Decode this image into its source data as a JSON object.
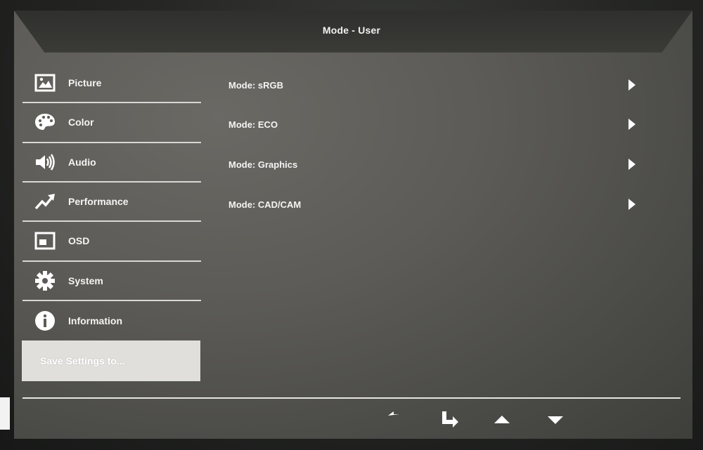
{
  "header": {
    "title": "Mode - User"
  },
  "menu": {
    "items": [
      {
        "id": "picture",
        "label": "Picture",
        "icon": "picture-icon"
      },
      {
        "id": "color",
        "label": "Color",
        "icon": "palette-icon"
      },
      {
        "id": "audio",
        "label": "Audio",
        "icon": "speaker-icon"
      },
      {
        "id": "performance",
        "label": "Performance",
        "icon": "trend-arrow-icon"
      },
      {
        "id": "osd",
        "label": "OSD",
        "icon": "osd-window-icon"
      },
      {
        "id": "system",
        "label": "System",
        "icon": "gear-icon"
      },
      {
        "id": "information",
        "label": "Information",
        "icon": "info-icon"
      }
    ],
    "save": {
      "label": "Save Settings to...",
      "selected": true
    }
  },
  "modes": [
    {
      "label": "Mode: sRGB",
      "icon": "arrow-right-icon"
    },
    {
      "label": "Mode: ECO",
      "icon": "arrow-right-icon"
    },
    {
      "label": "Mode: Graphics",
      "icon": "arrow-right-icon"
    },
    {
      "label": "Mode: CAD/CAM",
      "icon": "arrow-right-icon"
    }
  ],
  "nav": [
    {
      "id": "back",
      "icon": "back-arrow-icon"
    },
    {
      "id": "enter",
      "icon": "enter-arrow-icon"
    },
    {
      "id": "up",
      "icon": "triangle-up-icon"
    },
    {
      "id": "down",
      "icon": "triangle-down-icon"
    }
  ],
  "colors": {
    "osd_bg": "#5c5b57",
    "text": "#f4f4f4",
    "highlight": "#e0dfdc"
  }
}
